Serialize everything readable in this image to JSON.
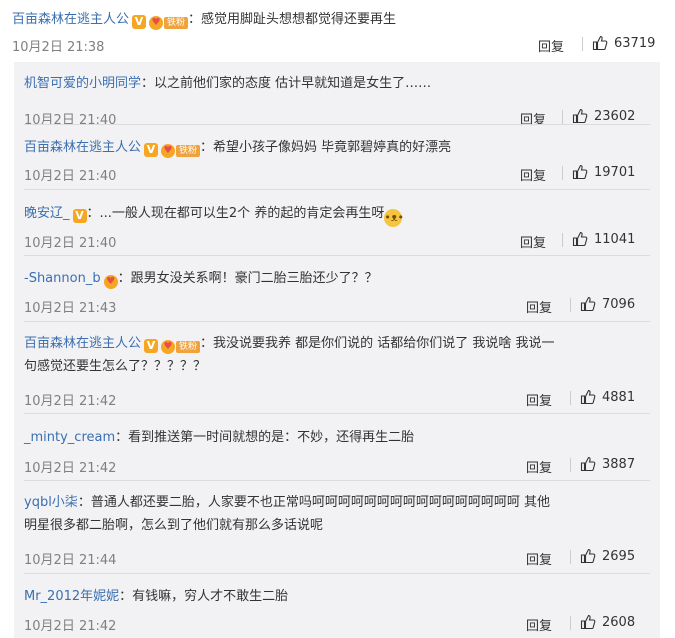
{
  "top": {
    "user": "百亩森林在逃主人公",
    "text": "：感觉用脚趾头想想都觉得还要再生",
    "time": "10月2日 21:38",
    "reply": "回复",
    "likes": "63719",
    "fan_label": "铁粉"
  },
  "replies": [
    {
      "user": "机智可爱的小明同学",
      "text": "：以之前他们家的态度 估计早就知道是女生了……",
      "time": "10月2日 21:40",
      "reply": "回复",
      "likes": "23602"
    },
    {
      "user": "百亩森林在逃主人公",
      "text": "：希望小孩子像妈妈 毕竟郭碧婷真的好漂亮",
      "time": "10月2日 21:40",
      "reply": "回复",
      "likes": "19701",
      "fan_label": "铁粉"
    },
    {
      "user": "晚安辽_",
      "text": "：...一般人现在都可以生2个 养的起的肯定会再生呀",
      "time": "10月2日 21:40",
      "reply": "回复",
      "likes": "11041"
    },
    {
      "user": "-Shannon_b",
      "text": "：跟男女没关系啊！豪门二胎三胎还少了？？",
      "time": "10月2日 21:43",
      "reply": "回复",
      "likes": "7096"
    },
    {
      "user": "百亩森林在逃主人公",
      "text": "：我没说要我养 都是你们说的 话都给你们说了 我说啥 我说一",
      "text2": "句感觉还要生怎么了？？？？？",
      "time": "10月2日 21:42",
      "reply": "回复",
      "likes": "4881",
      "fan_label": "铁粉"
    },
    {
      "user": "_minty_cream",
      "text": "：看到推送第一时间就想的是：不妙，还得再生二胎",
      "time": "10月2日 21:42",
      "reply": "回复",
      "likes": "3887"
    },
    {
      "user": "yqbl小柒",
      "text": "：普通人都还要二胎，人家要不也正常吗呵呵呵呵呵呵呵呵呵呵呵呵呵呵呵呵 其他",
      "text2": "明星很多都二胎啊，怎么到了他们就有那么多话说呢",
      "time": "10月2日 21:44",
      "reply": "回复",
      "likes": "2695"
    },
    {
      "user": "Mr_2012年妮妮",
      "text": "：有钱嘛，穷人才不敢生二胎",
      "time": "10月2日 21:42",
      "reply": "回复",
      "likes": "2608"
    }
  ],
  "icons": {
    "like": "thumbs-up-icon",
    "verified": "verified-v-icon",
    "fan": "fan-heart-icon",
    "emoji": "doge-emoji-icon"
  },
  "colors": {
    "username": "#3b6fb0",
    "panel_bg": "#f2f2f5",
    "badge": "#f5a623"
  }
}
